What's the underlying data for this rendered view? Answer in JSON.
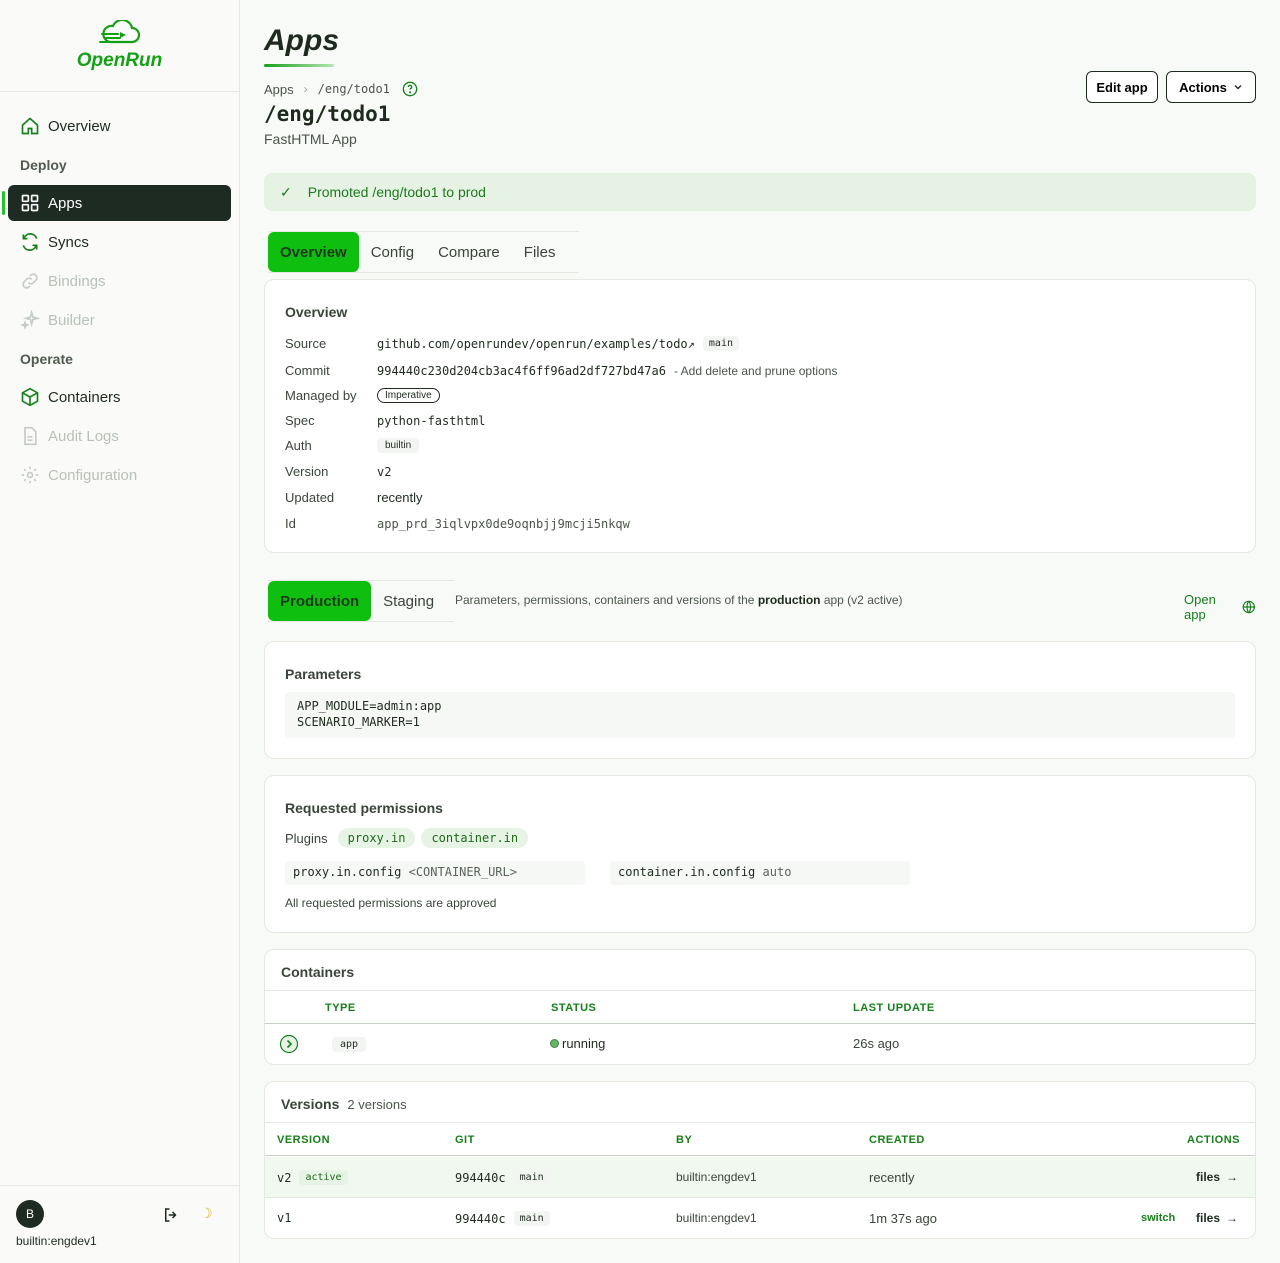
{
  "brand": {
    "name": "OpenRun"
  },
  "sidebar": {
    "items": [
      {
        "label": "Overview"
      },
      {
        "section": "Deploy"
      },
      {
        "label": "Apps"
      },
      {
        "label": "Syncs"
      },
      {
        "label": "Bindings"
      },
      {
        "label": "Builder"
      },
      {
        "section": "Operate"
      },
      {
        "label": "Containers"
      },
      {
        "label": "Audit Logs"
      },
      {
        "label": "Configuration"
      }
    ],
    "user": {
      "initial": "B",
      "name": "builtin:engdev1"
    }
  },
  "header": {
    "title": "Apps",
    "breadcrumb": {
      "root": "Apps",
      "current": "/eng/todo1"
    },
    "app_path": "/eng/todo1",
    "app_type": "FastHTML App",
    "edit_label": "Edit app",
    "actions_label": "Actions"
  },
  "alert": {
    "text": "Promoted /eng/todo1 to prod"
  },
  "tabs": [
    "Overview",
    "Config",
    "Compare",
    "Files"
  ],
  "overview": {
    "title": "Overview",
    "source_label": "Source",
    "source": "github.com/openrundev/openrun/examples/todo",
    "source_branch": "main",
    "commit_label": "Commit",
    "commit": "994440c230d204cb3ac4f6ff96ad2df727bd47a6",
    "commit_msg": "- Add delete and prune options",
    "managed_label": "Managed by",
    "managed": "Imperative",
    "spec_label": "Spec",
    "spec": "python-fasthtml",
    "auth_label": "Auth",
    "auth": "builtin",
    "version_label": "Version",
    "version": "v2",
    "updated_label": "Updated",
    "updated": "recently",
    "id_label": "Id",
    "id": "app_prd_3iqlvpx0de9oqnbjj9mcji5nkqw"
  },
  "env": {
    "tabs": [
      "Production",
      "Staging"
    ],
    "desc_pre": "Parameters, permissions, containers and versions of the",
    "desc_bold": "production",
    "desc_post": "app (v2 active)",
    "open_app": "Open app"
  },
  "parameters": {
    "title": "Parameters",
    "line1": "APP_MODULE=admin:app",
    "line2": "SCENARIO_MARKER=1"
  },
  "permissions": {
    "title": "Requested permissions",
    "plugins_label": "Plugins",
    "plugins": [
      "proxy.in",
      "container.in"
    ],
    "conf1_key": "proxy.in.config",
    "conf1_val": "<CONTAINER_URL>",
    "conf2_key": "container.in.config",
    "conf2_val": "auto",
    "note": "All requested permissions are approved"
  },
  "containers": {
    "title": "Containers",
    "headers": [
      "TYPE",
      "STATUS",
      "LAST UPDATE"
    ],
    "row": {
      "type": "app",
      "status": "running",
      "last_update": "26s ago"
    }
  },
  "versions": {
    "title": "Versions",
    "count": "2 versions",
    "headers": [
      "VERSION",
      "GIT",
      "BY",
      "CREATED",
      "ACTIONS"
    ],
    "rows": [
      {
        "version": "v2",
        "badge": "active",
        "git": "994440c",
        "branch": "main",
        "by": "builtin:engdev1",
        "created": "recently",
        "files": "files"
      },
      {
        "version": "v1",
        "git": "994440c",
        "branch": "main",
        "by": "builtin:engdev1",
        "created": "1m 37s ago",
        "switch": "switch",
        "files": "files"
      }
    ]
  },
  "colors": {
    "accent": "#0fbf0f",
    "sidebar_active": "#1e2b23",
    "link": "#16801a"
  }
}
